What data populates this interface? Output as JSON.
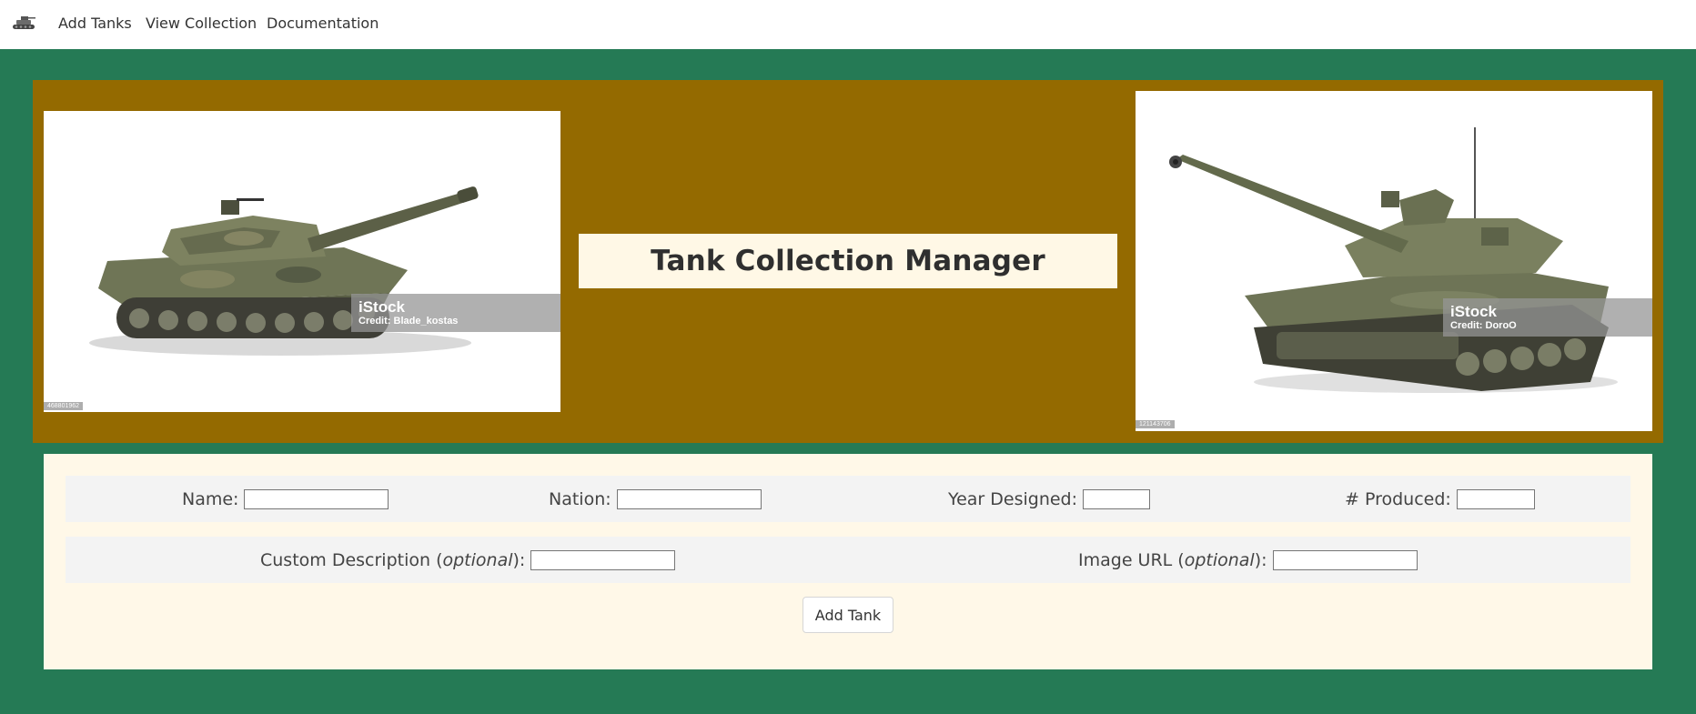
{
  "nav": {
    "brand_icon": "tank-icon",
    "links": [
      "Add Tanks",
      "View Collection",
      "Documentation"
    ]
  },
  "hero": {
    "title": "Tank Collection Manager",
    "left_image": {
      "brand": "iStock",
      "credit": "Credit: Blade_kostas",
      "stock_id": "468801962"
    },
    "right_image": {
      "brand": "iStock",
      "credit": "Credit: DoroO",
      "stock_id": "121143706"
    }
  },
  "form": {
    "row1": {
      "name_label": "Name:",
      "nation_label": "Nation:",
      "year_label": "Year Designed:",
      "produced_label": "# Produced:"
    },
    "row2": {
      "description_label": "Custom Description (",
      "description_optional": "optional",
      "description_suffix": "):",
      "image_label": "Image URL (",
      "image_optional": "optional",
      "image_suffix": "):"
    },
    "values": {
      "name": "",
      "nation": "",
      "year": "",
      "produced": "",
      "description": "",
      "image_url": ""
    },
    "submit_label": "Add Tank"
  },
  "colors": {
    "page_bg": "#257a55",
    "hero_bg": "#946a00",
    "panel_bg": "#fff8e8",
    "title_bg": "#fff8e6"
  }
}
